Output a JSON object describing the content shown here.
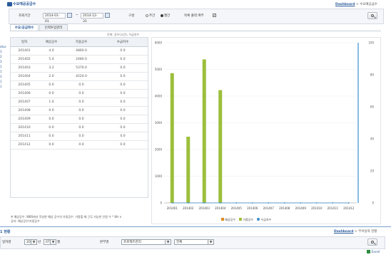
{
  "panel1": {
    "title": "수요예공공급수",
    "breadcrumb_link": "Dashboard",
    "breadcrumb_rest": "> 수요예공급수",
    "filter": {
      "period_label": "조회기간",
      "date_from": "2014-01-01",
      "date_sep": "~",
      "date_to": "2014-12-31",
      "type_label": "구성",
      "radio1_label": "주간",
      "radio2_label": "월간",
      "check_label": "목록 출력 여부",
      "check_mark": "✔"
    },
    "tabs": [
      "수요/공급목수",
      "인력투입관리"
    ],
    "unit_note": "단위: 공수(시간), 수급지수",
    "table": {
      "headers": [
        "일자",
        "예상공수",
        "가용공수",
        "수급지수"
      ],
      "rows": [
        [
          "201401",
          "4.0",
          "4860.0",
          "0.0"
        ],
        [
          "201402",
          "5.4",
          "2480.0",
          "0.0"
        ],
        [
          "201403",
          "3.2",
          "5376.0",
          "0.0"
        ],
        [
          "201404",
          "2.0",
          "4224.0",
          "0.0"
        ],
        [
          "201405",
          "0.0",
          "0.0",
          "0.0"
        ],
        [
          "201406",
          "0.0",
          "0.0",
          "0.0"
        ],
        [
          "201407",
          "1.0",
          "0.0",
          "0.0"
        ],
        [
          "201408",
          "0.0",
          "0.0",
          "0.0"
        ],
        [
          "201409",
          "0.0",
          "0.0",
          "0.0"
        ],
        [
          "201410",
          "0.0",
          "0.0",
          "0.0"
        ],
        [
          "201411",
          "0.0",
          "0.0",
          "0.0"
        ],
        [
          "201412",
          "0.0",
          "0.0",
          "0.0"
        ]
      ]
    },
    "footnote1": "※ 예상공수: WBS에서 작성한 예상 공수의 가용공수: 가용할 때 근무 가능한 인원 수 * 8H ×",
    "footnote2": "공지: 예상공수/가용공수",
    "left_cut": [
      "atus",
      "3",
      "2",
      "3",
      "1",
      "1",
      "3",
      "1",
      "1"
    ]
  },
  "chart_data": {
    "type": "bar",
    "categories": [
      "201401",
      "201402",
      "201403",
      "201404",
      "201405",
      "201406",
      "201407",
      "201408",
      "201409",
      "201410",
      "201411",
      "201412"
    ],
    "series": [
      {
        "name": "예상공수",
        "values": [
          4.0,
          5.4,
          3.2,
          2.0,
          0,
          0,
          1.0,
          0,
          0,
          0,
          0,
          0
        ],
        "color": "#e08a1e"
      },
      {
        "name": "가용공수",
        "values": [
          4860,
          2480,
          5376,
          4224,
          0,
          0,
          0,
          0,
          0,
          0,
          0,
          0
        ],
        "color": "#9cbf3b"
      },
      {
        "name": "수급지수",
        "values": [
          0,
          0,
          0,
          0,
          0,
          0,
          0,
          0,
          0,
          0,
          0,
          0
        ],
        "color": "#3a8fd1"
      }
    ],
    "ylim": [
      0,
      6000
    ],
    "y_ticks": [
      "0",
      "1000",
      "2000",
      "3000",
      "4000",
      "5000",
      "6000"
    ],
    "ylim_right": [
      0,
      100
    ],
    "y_ticks_right": [
      "0",
      "20",
      "40",
      "60",
      "80",
      "100"
    ],
    "legend": "bottom",
    "grid": true
  },
  "panel2": {
    "title_tail": "1 현황",
    "breadcrumb_link": "Dashboard",
    "breadcrumb_rest": "> 부서실적 현황",
    "left_label": "일자명",
    "year": "2014",
    "year_suffix": "년",
    "month": "07",
    "month_suffix": "월",
    "dept_label": "본부명",
    "dept_value": "프로젝트관리",
    "sub_value": "전체",
    "excel_label": "Excel"
  },
  "colors": {
    "accent": "#2a5a9a",
    "bar_green": "#9cbf3b",
    "bar_orange": "#e08a1e",
    "axis_blue": "#3a8fd1"
  }
}
